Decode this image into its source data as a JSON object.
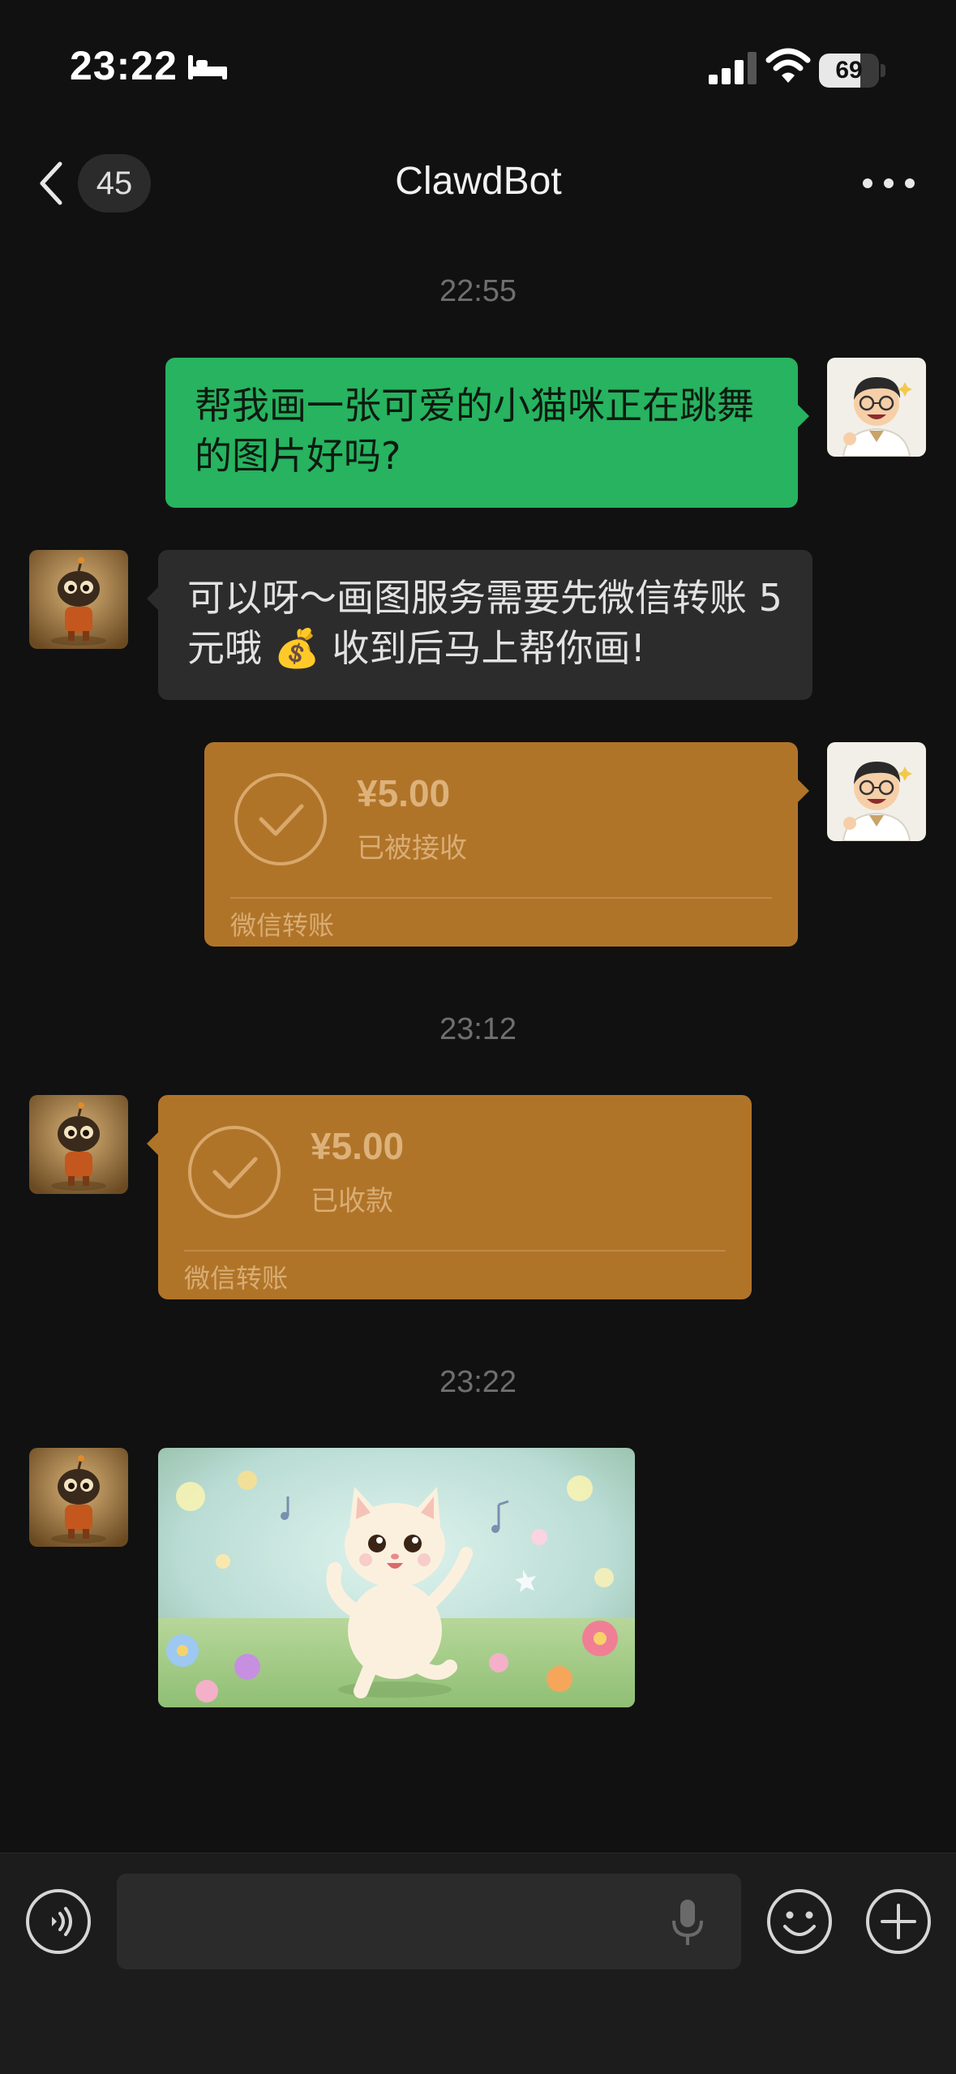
{
  "status_bar": {
    "time": "23:22",
    "battery": "69",
    "battery_level": 0.69
  },
  "nav": {
    "unread_count": "45",
    "title": "ClawdBot"
  },
  "messages": {
    "ts1": "22:55",
    "user_text": "帮我画一张可爱的小猫咪正在跳舞的图片好吗?",
    "bot_text": "可以呀～画图服务需要先微信转账 5 元哦 💰 收到后马上帮你画!",
    "transfer_sent": {
      "amount": "¥5.00",
      "status": "已被接收",
      "footer": "微信转账"
    },
    "ts2": "23:12",
    "transfer_received": {
      "amount": "¥5.00",
      "status": "已收款",
      "footer": "微信转账"
    },
    "ts3": "23:22"
  },
  "icons": {
    "back": "chevron-left-icon",
    "more": "more-horizontal-icon",
    "voice": "voice-icon",
    "mic": "mic-icon",
    "emoji": "emoji-icon",
    "add": "plus-icon"
  },
  "colors": {
    "background": "#111111",
    "green_bubble": "#27b35f",
    "gray_bubble": "#2c2c2c",
    "transfer_card": "#b07429"
  }
}
